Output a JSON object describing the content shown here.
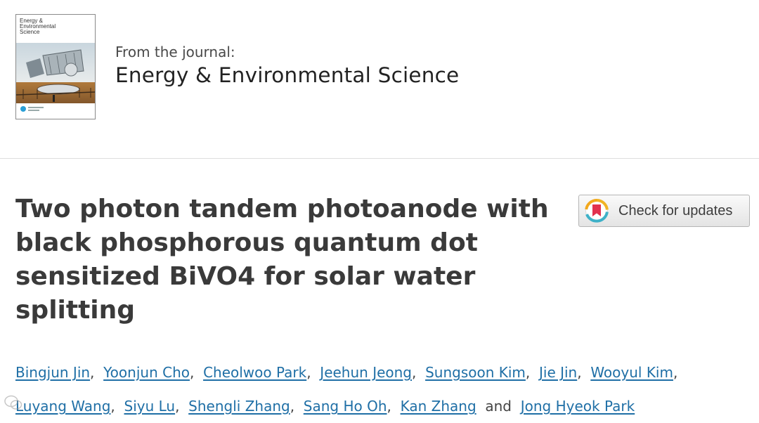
{
  "journal": {
    "from_label": "From the journal:",
    "name": "Energy & Environmental Science",
    "cover_title": "Energy &\nEnvironmental\nScience"
  },
  "article": {
    "title": "Two photon tandem photoanode with black phosphorous quantum dot sensitized BiVO4 for solar water splitting"
  },
  "updates_button": {
    "label": "Check for updates",
    "icon": "crossmark-icon"
  },
  "authors": {
    "line1": [
      "Bingjun Jin",
      "Yoonjun Cho",
      "Cheolwoo Park",
      "Jeehun Jeong",
      "Sungsoon Kim",
      "Jie Jin",
      "Wooyul Kim"
    ],
    "line2": [
      "Luyang Wang",
      "Siyu Lu",
      "Shengli Zhang",
      "Sang Ho Oh",
      "Kan Zhang"
    ],
    "conjunction": "and",
    "last": "Jong Hyeok Park",
    "separator": ","
  },
  "colors": {
    "link": "#1f6fa6",
    "title": "#3a3a3a",
    "divider": "#dedede"
  },
  "watermark_icon": "wechat-watermark-icon"
}
